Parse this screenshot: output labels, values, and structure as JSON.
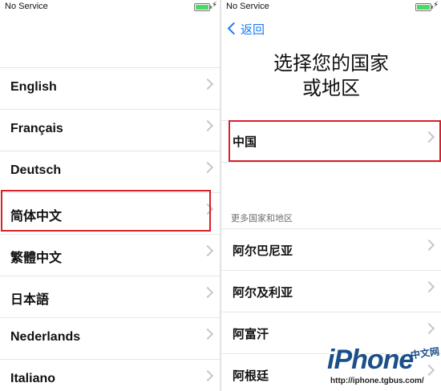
{
  "left_screen": {
    "status": {
      "carrier": "No Service"
    },
    "languages": [
      "English",
      "Français",
      "Deutsch",
      "简体中文",
      "繁體中文",
      "日本語",
      "Nederlands",
      "Italiano"
    ]
  },
  "right_screen": {
    "status": {
      "carrier": "No Service"
    },
    "back_label": "返回",
    "title_line1": "选择您的国家",
    "title_line2": "或地区",
    "primary_country": "中国",
    "section_header": "更多国家和地区",
    "countries": [
      "阿尔巴尼亚",
      "阿尔及利亚",
      "阿富汗",
      "阿根廷"
    ]
  },
  "watermark": {
    "logo": "iPhone",
    "cn": "中文网",
    "url": "http://iphone.tgbus.com/"
  },
  "colors": {
    "accent_blue": "#1a7cf6",
    "highlight_red": "#d6202a",
    "battery_green": "#4cd964"
  }
}
